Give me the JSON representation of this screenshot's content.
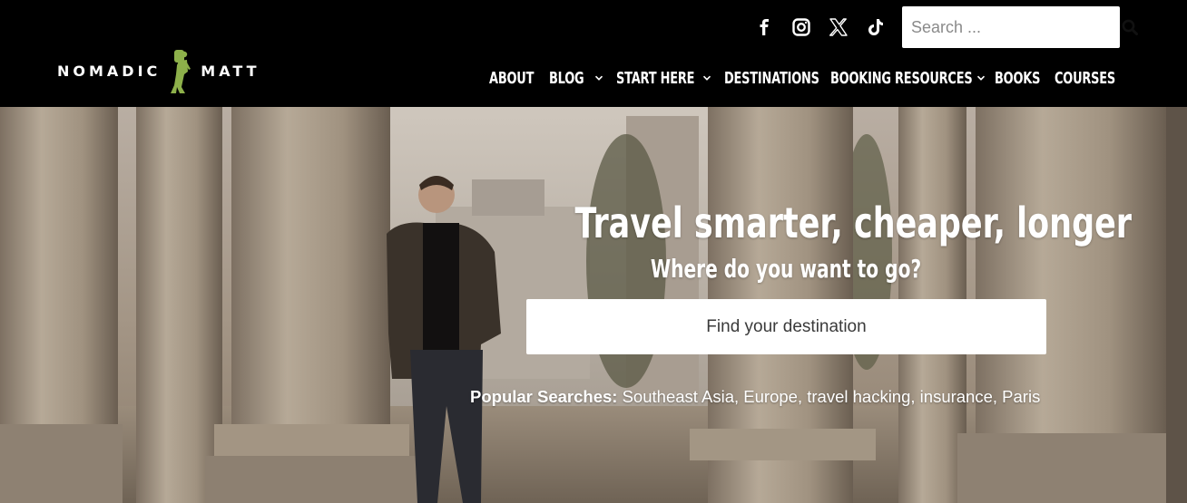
{
  "brand": {
    "word_left": "NOMADIC",
    "word_right": "MATT",
    "accent": "#8db04a"
  },
  "social": [
    {
      "icon": "facebook-icon"
    },
    {
      "icon": "instagram-icon"
    },
    {
      "icon": "x-icon"
    },
    {
      "icon": "tiktok-icon"
    }
  ],
  "top_search": {
    "placeholder": "Search ..."
  },
  "nav": {
    "items": [
      {
        "label": "ABOUT",
        "dropdown": false
      },
      {
        "label": "BLOG",
        "dropdown": true
      },
      {
        "label": "START HERE",
        "dropdown": true
      },
      {
        "label": "DESTINATIONS",
        "dropdown": false
      },
      {
        "label": "BOOKING RESOURCES",
        "dropdown": true
      },
      {
        "label": "BOOKS",
        "dropdown": false
      },
      {
        "label": "COURSES",
        "dropdown": false
      }
    ]
  },
  "hero": {
    "title": "Travel smarter, cheaper, longer",
    "subtitle": "Where do you want to go?",
    "search_placeholder": "Find your destination",
    "popular_label": "Popular Searches:",
    "popular_items": [
      "Southeast Asia",
      "Europe",
      "travel hacking",
      "insurance",
      "Paris"
    ]
  }
}
